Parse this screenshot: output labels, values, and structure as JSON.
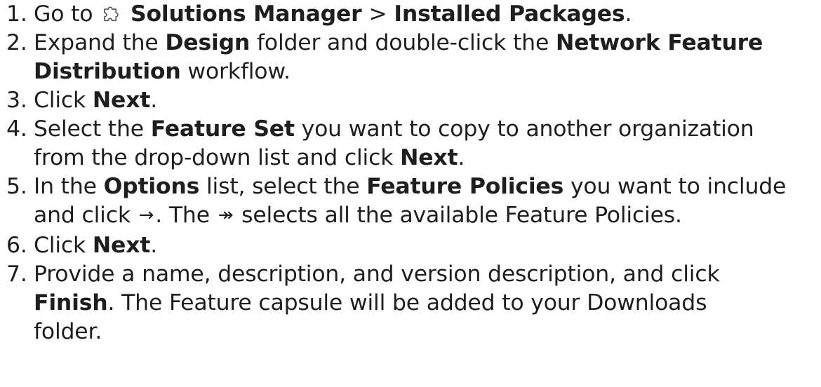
{
  "steps": [
    {
      "num": "1.",
      "lines": [
        [
          {
            "t": "Go to "
          },
          {
            "icon": "puzzle-icon"
          },
          {
            "t": " "
          },
          {
            "t": "Solutions Manager",
            "b": true
          },
          {
            "t": " > "
          },
          {
            "t": "Installed Packages",
            "b": true
          },
          {
            "t": "."
          }
        ]
      ]
    },
    {
      "num": "2.",
      "lines": [
        [
          {
            "t": "Expand the "
          },
          {
            "t": "Design",
            "b": true
          },
          {
            "t": " folder and double-click the "
          },
          {
            "t": "Network Feature",
            "b": true
          }
        ],
        [
          {
            "t": "Distribution",
            "b": true
          },
          {
            "t": " workflow."
          }
        ]
      ]
    },
    {
      "num": "3.",
      "lines": [
        [
          {
            "t": "Click "
          },
          {
            "t": "Next",
            "b": true
          },
          {
            "t": "."
          }
        ]
      ]
    },
    {
      "num": "4.",
      "lines": [
        [
          {
            "t": "Select the "
          },
          {
            "t": "Feature Set",
            "b": true
          },
          {
            "t": " you want to copy to another organization"
          }
        ],
        [
          {
            "t": "from the drop-down list and click "
          },
          {
            "t": "Next",
            "b": true
          },
          {
            "t": "."
          }
        ]
      ]
    },
    {
      "num": "5.",
      "lines": [
        [
          {
            "t": "In the "
          },
          {
            "t": "Options",
            "b": true
          },
          {
            "t": " list, select the "
          },
          {
            "t": "Feature Policies",
            "b": true
          },
          {
            "t": " you want to include"
          }
        ],
        [
          {
            "t": "and click "
          },
          {
            "arrow": "→",
            "name": "add-arrow-icon"
          },
          {
            "t": ". The "
          },
          {
            "arrow": "↠",
            "name": "add-all-arrow-icon"
          },
          {
            "t": " selects all the available Feature Policies."
          }
        ]
      ]
    },
    {
      "num": "6.",
      "lines": [
        [
          {
            "t": "Click "
          },
          {
            "t": "Next",
            "b": true
          },
          {
            "t": "."
          }
        ]
      ]
    },
    {
      "num": "7.",
      "lines": [
        [
          {
            "t": "Provide a name, description, and version description, and click"
          }
        ],
        [
          {
            "t": "Finish",
            "b": true
          },
          {
            "t": ". The Feature capsule will be added to your Downloads"
          }
        ],
        [
          {
            "t": "folder."
          }
        ]
      ]
    }
  ]
}
